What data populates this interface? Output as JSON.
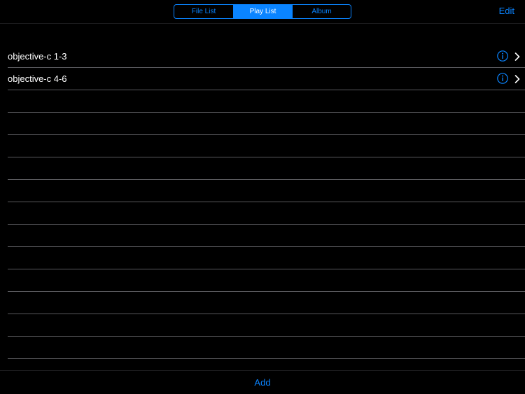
{
  "nav": {
    "segments": [
      {
        "label": "File List",
        "selected": false
      },
      {
        "label": "Play List",
        "selected": true
      },
      {
        "label": "Album",
        "selected": false
      }
    ],
    "edit_label": "Edit"
  },
  "table": {
    "rows": [
      {
        "label": "objective-c 1-3",
        "accessory": "info-chevron"
      },
      {
        "label": "objective-c 4-6",
        "accessory": "info-chevron"
      },
      {
        "label": "",
        "accessory": "none"
      },
      {
        "label": "",
        "accessory": "none"
      },
      {
        "label": "",
        "accessory": "none"
      },
      {
        "label": "",
        "accessory": "none"
      },
      {
        "label": "",
        "accessory": "none"
      },
      {
        "label": "",
        "accessory": "none"
      },
      {
        "label": "",
        "accessory": "none"
      },
      {
        "label": "",
        "accessory": "none"
      },
      {
        "label": "",
        "accessory": "none"
      },
      {
        "label": "",
        "accessory": "none"
      },
      {
        "label": "",
        "accessory": "none"
      },
      {
        "label": "",
        "accessory": "none"
      }
    ]
  },
  "toolbar": {
    "add_label": "Add"
  },
  "colors": {
    "accent": "#0a84ff",
    "background": "#000000",
    "separator": "#5a5a5e",
    "text": "#ffffff"
  },
  "icons": {
    "info": "info-circle-icon",
    "chevron": "chevron-right-icon"
  }
}
